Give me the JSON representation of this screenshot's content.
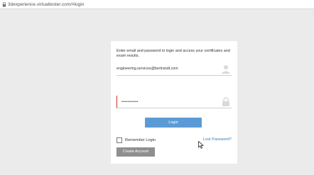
{
  "browser": {
    "url": "3dexperience.virtualtester.com/#login",
    "url_icon": "lock-icon"
  },
  "login_card": {
    "intro_text": "Enter email and password to login and access your certificates and exam results.",
    "email": {
      "value": "engineering.services@bertrandt.com",
      "icon": "user-icon"
    },
    "password": {
      "value": "•••••••••••",
      "icon": "lock-icon"
    },
    "login_button": "Login",
    "remember_label": "Remember Login",
    "remember_checked": false,
    "lost_password_link": "Lost Password?",
    "create_account_button": "Create Account"
  },
  "colors": {
    "page_background": "#ebebeb",
    "card_background": "#ffffff",
    "login_button": "#5b9bd5",
    "create_account_button": "#8f8f8f",
    "link": "#337ab7",
    "password_error_accent": "#c9302c"
  },
  "cursor_icon": "mouse-pointer-icon"
}
